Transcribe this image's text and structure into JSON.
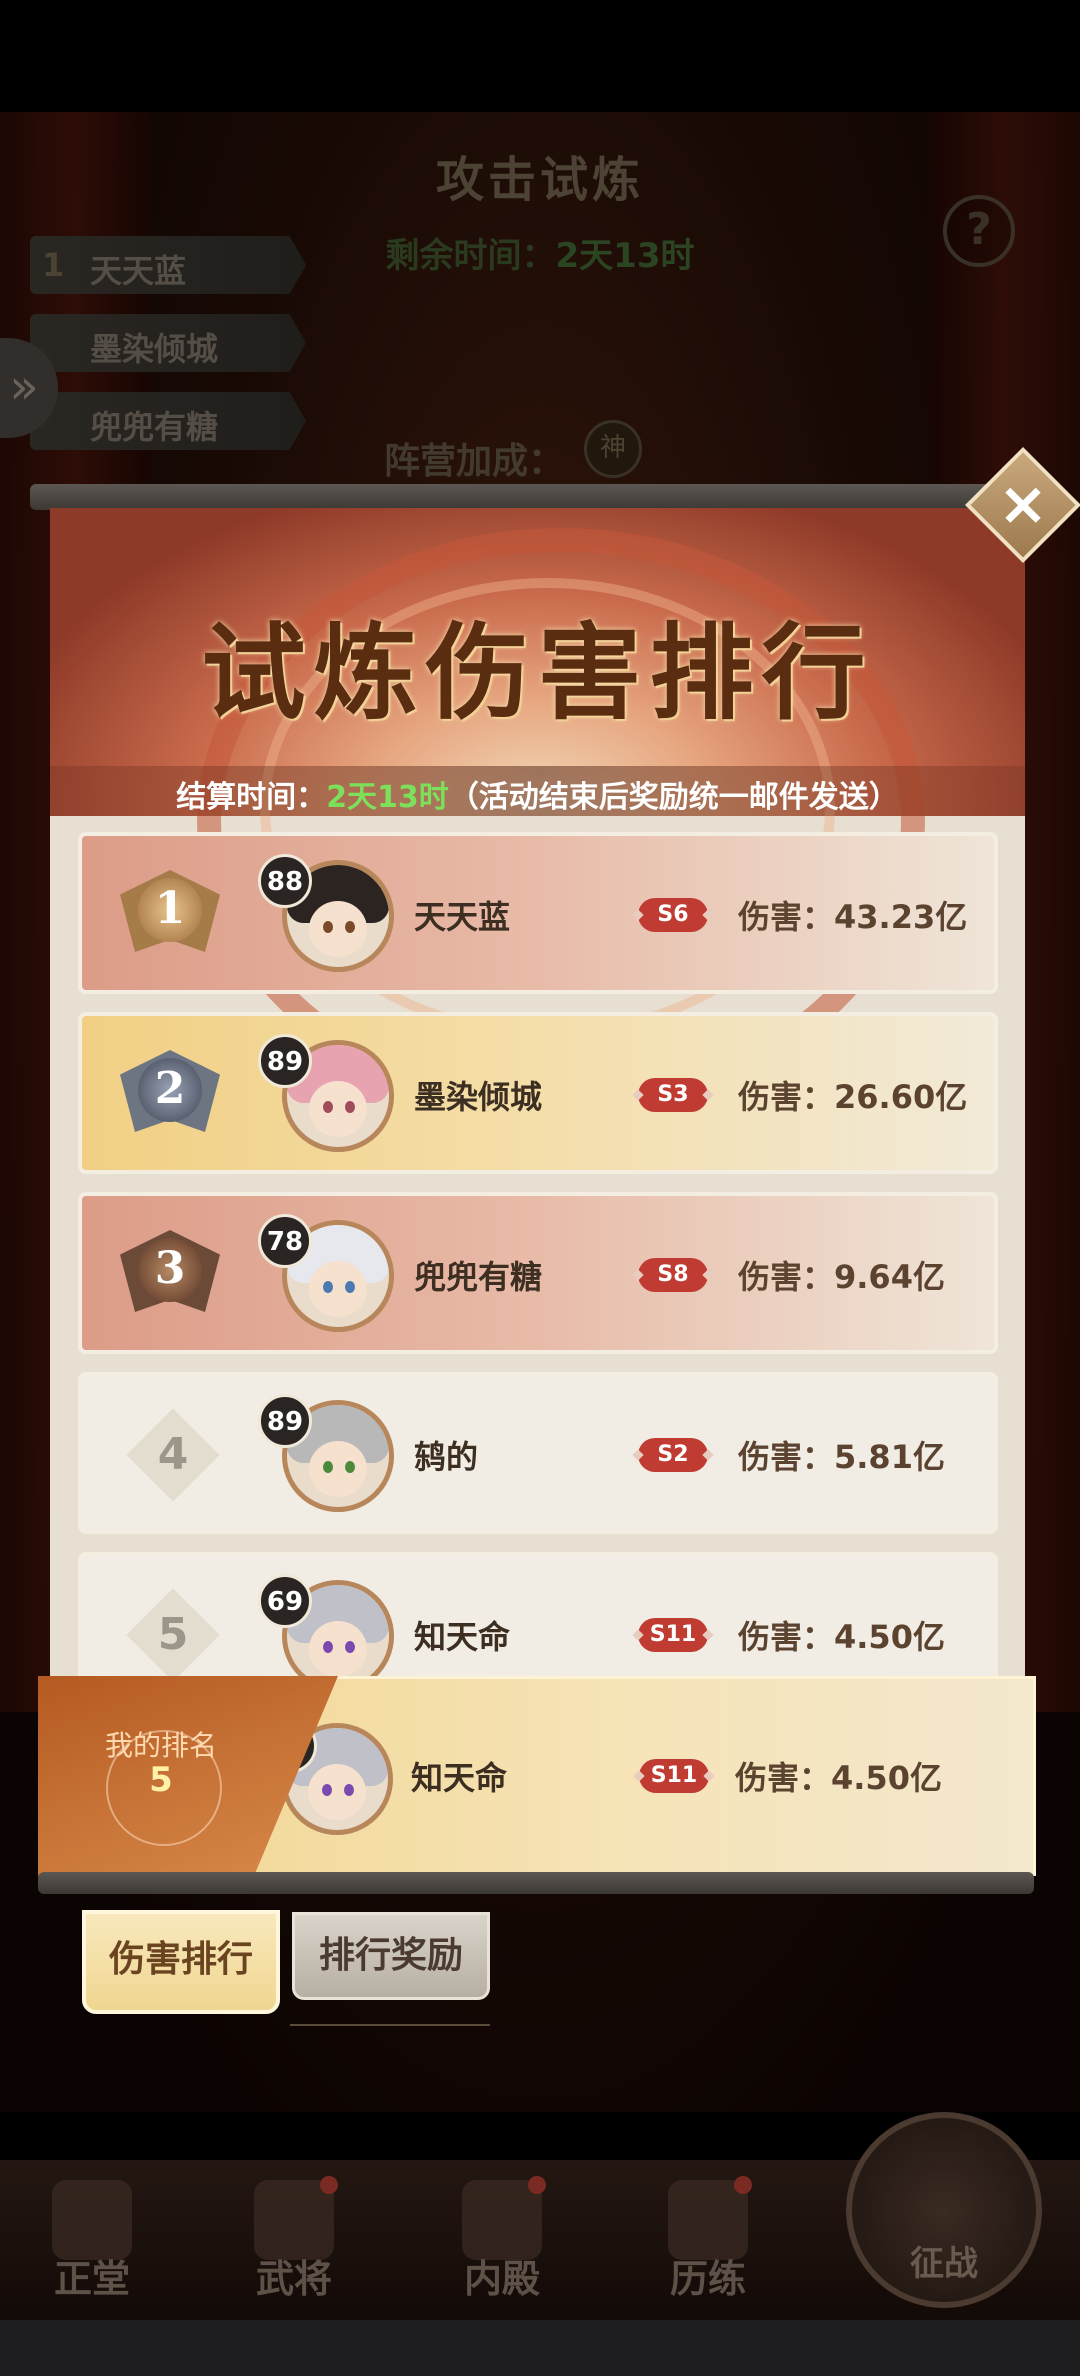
{
  "background": {
    "title": "攻击试炼",
    "remaining_label": "剩余时间：",
    "remaining_value": "2天13时",
    "help": "?",
    "side_ranks": [
      {
        "num": "1",
        "name": "天天蓝"
      },
      {
        "num": "",
        "name": "墨染倾城"
      },
      {
        "num": "",
        "name": "兜兜有糖"
      }
    ],
    "camp_label": "阵营加成：",
    "camp_badge": "神"
  },
  "panel": {
    "title": "试炼伤害排行",
    "settle_label": "结算时间：",
    "settle_value": "2天13时",
    "settle_note": "（活动结束后奖励统一邮件发送）",
    "close": "×"
  },
  "ranking": [
    {
      "rank": "1",
      "level": "88",
      "name": "天天蓝",
      "server": "S6",
      "damage": "伤害：43.23亿",
      "hair": "#2b2420",
      "eye": "#7a4a2a"
    },
    {
      "rank": "2",
      "level": "89",
      "name": "墨染倾城",
      "server": "S3",
      "damage": "伤害：26.60亿",
      "hair": "#e7a4b0",
      "eye": "#a04a5a"
    },
    {
      "rank": "3",
      "level": "78",
      "name": "兜兜有糖",
      "server": "S8",
      "damage": "伤害：9.64亿",
      "hair": "#e6e8ee",
      "eye": "#4a7ab0"
    },
    {
      "rank": "4",
      "level": "89",
      "name": "鸫的",
      "server": "S2",
      "damage": "伤害：5.81亿",
      "hair": "#b8b8b8",
      "eye": "#4a8a3a"
    },
    {
      "rank": "5",
      "level": "69",
      "name": "知天命",
      "server": "S11",
      "damage": "伤害：4.50亿",
      "hair": "#c0c0c8",
      "eye": "#7a4ab0"
    }
  ],
  "my_rank": {
    "label": "我的排名",
    "rank": "5",
    "level": "69",
    "name": "知天命",
    "server": "S11",
    "damage": "伤害：4.50亿"
  },
  "tabs": {
    "damage": "伤害排行",
    "rewards": "排行奖励"
  },
  "bottom_nav": [
    "正堂",
    "武将",
    "内殿",
    "历练",
    "征战"
  ]
}
